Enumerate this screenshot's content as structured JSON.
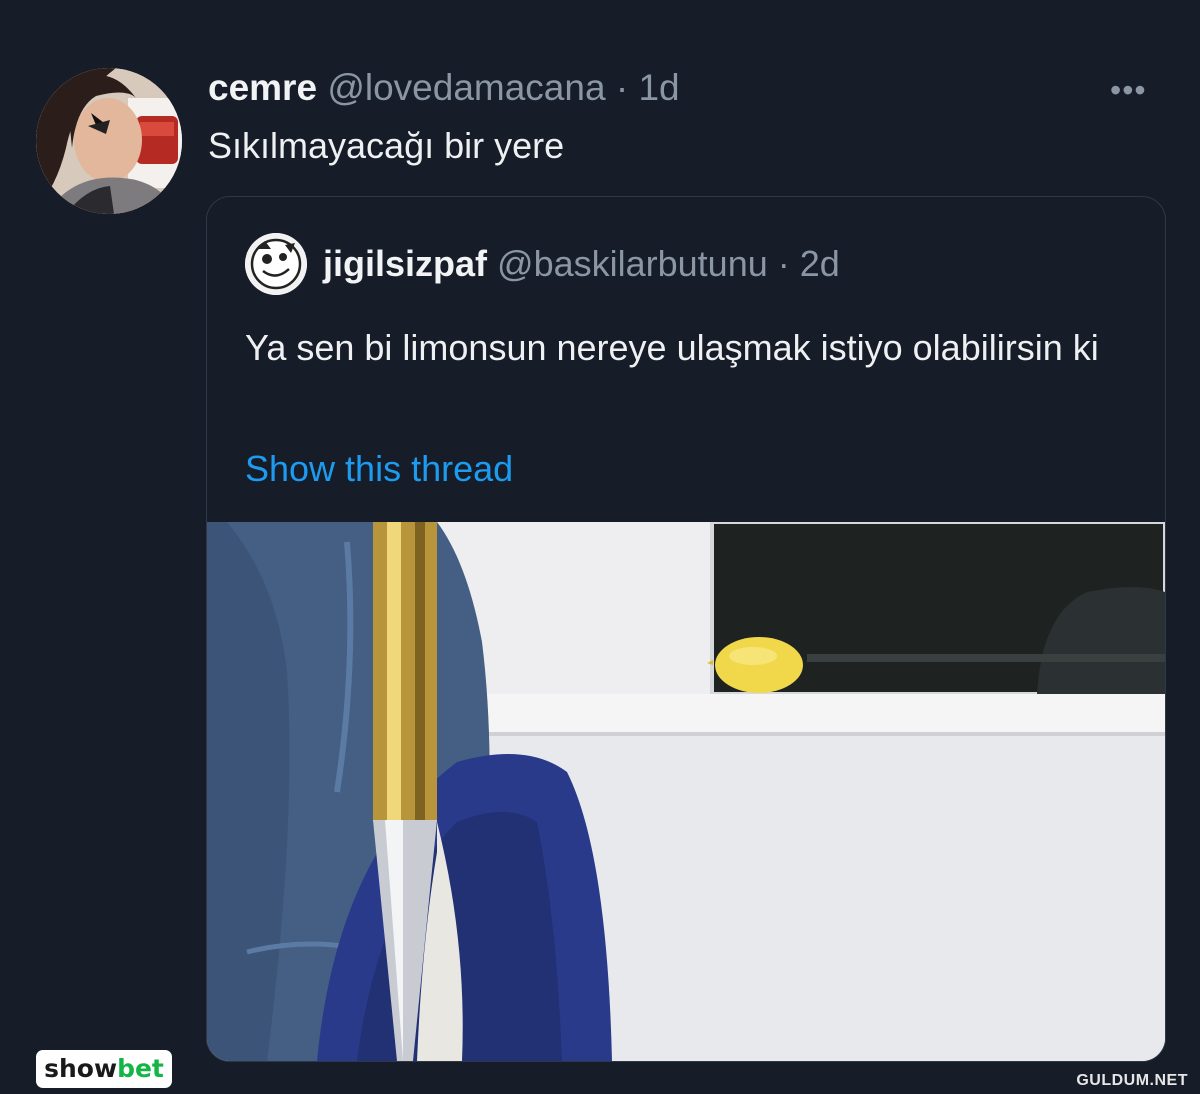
{
  "tweet": {
    "author_name": "cemre",
    "handle": "@lovedamacana",
    "time": "1d",
    "text": "Sıkılmayacağı bir yere",
    "more_icon": "more-horizontal-icon"
  },
  "quoted_tweet": {
    "author_name": "jigilsizpaf",
    "handle": "@baskilarbutunu",
    "time": "2d",
    "text": "Ya sen bi limonsun nereye ulaşmak istiyo olabilirsin ki",
    "show_thread": "Show this thread"
  },
  "watermarks": {
    "left_show": "show",
    "left_bet": "bet",
    "right": "GULDUM.NET"
  },
  "colors": {
    "background": "#161c28",
    "link": "#1d9bf0",
    "muted": "#8a96a4",
    "lemon": "#f0d84a"
  }
}
